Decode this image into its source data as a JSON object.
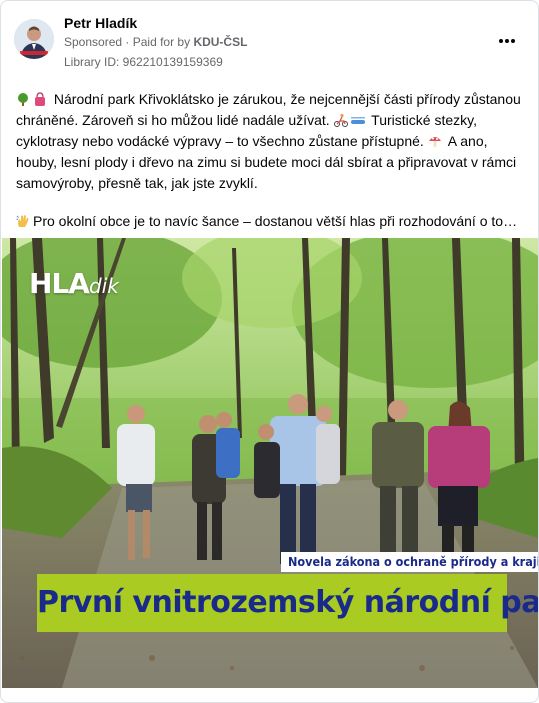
{
  "post": {
    "author": "Petr Hladík",
    "sponsored": "Sponsored",
    "paid_for_prefix": "· Paid for by",
    "paid_for_by": "KDU-ČSL",
    "library_id": "Library ID: 962210139159369"
  },
  "body": {
    "p1_a": "Národní park Křivoklátsko je zárukou, že nejcennější části přírody zůstanou chráněné. Zároveň si ho můžou lidé nadále užívat.",
    "p1_b": "Turistické stezky, cyklotrasy nebo vodácké výpravy – to všechno zůstane přístupné.",
    "p1_c": "A ano, houby, lesní plody i dřevo na zimu si budete moci dál sbírat a připravovat v rámci samovýroby, přesně tak, jak jste zvyklí.",
    "p2": "Pro okolní obce je to navíc šance – dostanou větší hlas při rozhodování o tom…"
  },
  "image": {
    "logo_main": "HLA",
    "logo_italic": "dik",
    "subtitle": "Novela zákona o ochraně přírody a krajiny",
    "headline": "První vnitrozemský národní park",
    "colors": {
      "banner": "#a9cb22",
      "text": "#1a2a8a"
    }
  },
  "icons": [
    "tree-icon",
    "shopping-bag-icon",
    "cyclist-icon",
    "kayak-icon",
    "mushroom-icon",
    "waving-hand-icon",
    "more-options-icon"
  ]
}
